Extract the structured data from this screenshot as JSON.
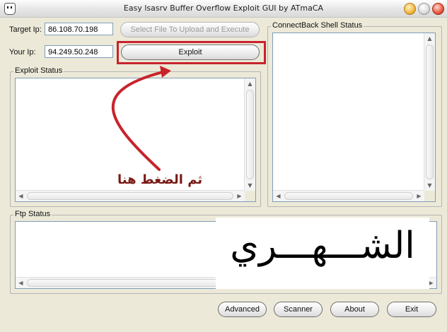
{
  "window": {
    "title": "Easy lsasrv Buffer Overflow Exploit GUI by ATmaCA"
  },
  "form": {
    "target_ip_label": "Target Ip:",
    "target_ip_value": "86.108.70.198",
    "your_ip_label": "Your Ip:",
    "your_ip_value": "94.249.50.248",
    "select_file_button": "Select File To Upload and Execute",
    "exploit_button": "Exploit"
  },
  "panels": {
    "exploit_status": "Exploit Status",
    "connectback_status": "ConnectBack Shell Status",
    "ftp_status": "Ftp Status"
  },
  "footer": {
    "advanced": "Advanced",
    "scanner": "Scanner",
    "about": "About",
    "exit": "Exit"
  },
  "annotation": {
    "instruction_text": "ثم الضغط هنا",
    "highlight_color": "#c8232c",
    "arrow_color": "#c8232c",
    "signature_text": "الشـــهـــري"
  },
  "icons": {
    "app": "app-logo-icon",
    "minimize": "minimize-icon",
    "maximize": "maximize-icon",
    "close": "close-icon"
  }
}
